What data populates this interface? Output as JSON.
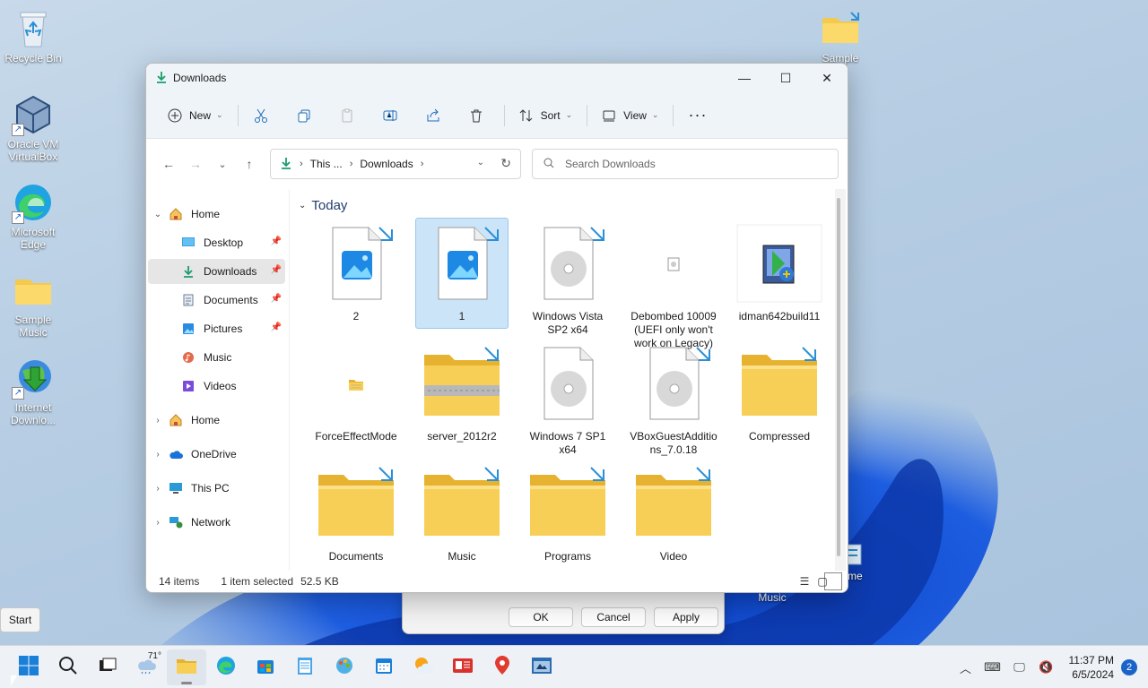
{
  "desktop": {
    "icons": [
      {
        "label": "Recycle Bin"
      },
      {
        "label": "Oracle VM VirtualBox"
      },
      {
        "label": "Microsoft Edge"
      },
      {
        "label": "Sample Music"
      },
      {
        "label": "Internet Downlo..."
      },
      {
        "label": "Sample"
      },
      {
        "label": "Music"
      },
      {
        "label": "eme"
      }
    ]
  },
  "start_tooltip": "Start",
  "behind_dialog": {
    "ok": "OK",
    "cancel": "Cancel",
    "apply": "Apply"
  },
  "window": {
    "title": "Downloads",
    "toolbar": {
      "new_label": "New",
      "sort_label": "Sort",
      "view_label": "View"
    },
    "address": {
      "crumbs": [
        "This ...",
        "Downloads"
      ]
    },
    "search_placeholder": "Search Downloads",
    "sidebar": [
      {
        "label": "Home",
        "expand": "expanded"
      },
      {
        "label": "Desktop",
        "pinned": true
      },
      {
        "label": "Downloads",
        "pinned": true,
        "selected": true
      },
      {
        "label": "Documents",
        "pinned": true
      },
      {
        "label": "Pictures",
        "pinned": true
      },
      {
        "label": "Music"
      },
      {
        "label": "Videos"
      },
      {
        "label": "Home",
        "expand": "collapsed"
      },
      {
        "label": "OneDrive",
        "expand": "collapsed"
      },
      {
        "label": "This PC",
        "expand": "collapsed"
      },
      {
        "label": "Network",
        "expand": "collapsed"
      }
    ],
    "group_header": "Today",
    "files": [
      {
        "name": "2",
        "type": "image"
      },
      {
        "name": "1",
        "type": "image",
        "selected": true
      },
      {
        "name": "Windows Vista SP2 x64",
        "type": "disc"
      },
      {
        "name": "Debombed 10009 (UEFI only won't work on Legacy)",
        "type": "small-file"
      },
      {
        "name": "idman642build11",
        "type": "installer"
      },
      {
        "name": "ForceEffectMode",
        "type": "small-folder"
      },
      {
        "name": "server_2012r2",
        "type": "zip"
      },
      {
        "name": "Windows 7 SP1 x64",
        "type": "disc-plain"
      },
      {
        "name": "VBoxGuestAdditions_7.0.18",
        "type": "disc"
      },
      {
        "name": "Compressed",
        "type": "folder"
      },
      {
        "name": "Documents",
        "type": "folder"
      },
      {
        "name": "Music",
        "type": "folder"
      },
      {
        "name": "Programs",
        "type": "folder"
      },
      {
        "name": "Video",
        "type": "folder"
      }
    ],
    "status": {
      "count": "14 items",
      "selected": "1 item selected",
      "size": "52.5 KB"
    }
  },
  "taskbar": {
    "weather_temp": "71°",
    "time": "11:37 PM",
    "date": "6/5/2024",
    "notification_count": "2"
  }
}
